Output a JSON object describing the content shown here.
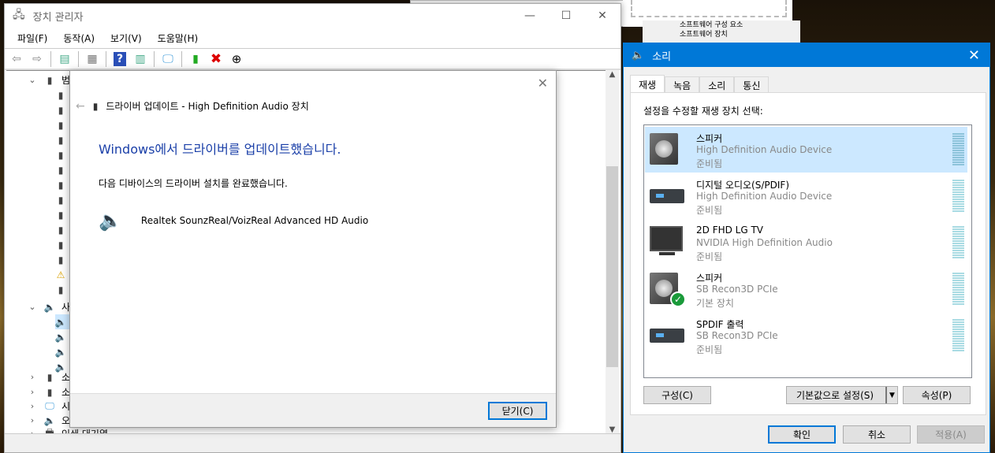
{
  "background": {
    "tree_items": [
      "소프트웨어 구성 요소",
      "소프트웨어 장치"
    ]
  },
  "device_manager": {
    "title": "장치 관리자",
    "window_controls": {
      "minimize": "—",
      "maximize": "☐",
      "close": "✕"
    },
    "menu": [
      "파일(F)",
      "동작(A)",
      "보기(V)",
      "도움말(H)"
    ],
    "toolbar_icons": [
      "back-icon",
      "forward-icon",
      "show-hide-tree-icon",
      "properties-icon",
      "help-icon",
      "action-pane-icon",
      "scan-hardware-icon",
      "update-driver-icon",
      "uninstall-icon",
      "disable-icon"
    ],
    "tree": [
      {
        "label": "범",
        "expanded": true,
        "level": 0,
        "icon": "usb-icon"
      },
      {
        "label": "사",
        "expanded": true,
        "level": 0,
        "icon": "speaker-icon"
      },
      {
        "label": "소",
        "expanded": false,
        "level": 0,
        "icon": "software-component-icon"
      },
      {
        "label": "소",
        "expanded": false,
        "level": 0,
        "icon": "software-device-icon"
      },
      {
        "label": "시",
        "expanded": false,
        "level": 0,
        "icon": "system-device-icon"
      },
      {
        "label": "오",
        "expanded": false,
        "level": 0,
        "icon": "speaker-icon"
      },
      {
        "label": "인쇄 대기열",
        "expanded": false,
        "level": 0,
        "icon": "printer-icon"
      }
    ]
  },
  "driver_dialog": {
    "header": "드라이버 업데이트 - High Definition Audio 장치",
    "heading": "Windows에서 드라이버를 업데이트했습니다.",
    "message": "다음 디바이스의 드라이버 설치를 완료했습니다.",
    "device_name": "Realtek SounzReal/VoizReal Advanced HD Audio",
    "close_button": "닫기(C)",
    "close_x": "✕",
    "back_arrow": "←"
  },
  "sound": {
    "title": "소리",
    "close_x": "✕",
    "accent": "#0078d7",
    "tabs": [
      "재생",
      "녹음",
      "소리",
      "통신"
    ],
    "active_tab": 0,
    "instruction": "설정을 수정할 재생 장치 선택:",
    "devices": [
      {
        "name": "스피커",
        "driver": "High Definition Audio Device",
        "status": "준비됨",
        "icon": "speaker-box-icon",
        "selected": true,
        "default": false
      },
      {
        "name": "디지털 오디오(S/PDIF)",
        "driver": "High Definition Audio Device",
        "status": "준비됨",
        "icon": "receiver-icon",
        "selected": false,
        "default": false
      },
      {
        "name": "2D FHD LG TV",
        "driver": "NVIDIA High Definition Audio",
        "status": "준비됨",
        "icon": "monitor-icon",
        "selected": false,
        "default": false
      },
      {
        "name": "스피커",
        "driver": "SB Recon3D PCIe",
        "status": "기본 장치",
        "icon": "speaker-box-icon",
        "selected": false,
        "default": true
      },
      {
        "name": "SPDIF 출력",
        "driver": "SB Recon3D PCIe",
        "status": "준비됨",
        "icon": "receiver-icon",
        "selected": false,
        "default": false
      }
    ],
    "buttons": {
      "configure": "구성(C)",
      "set_default": "기본값으로 설정(S)",
      "properties": "속성(P)",
      "ok": "확인",
      "cancel": "취소",
      "apply": "적용(A)"
    }
  }
}
